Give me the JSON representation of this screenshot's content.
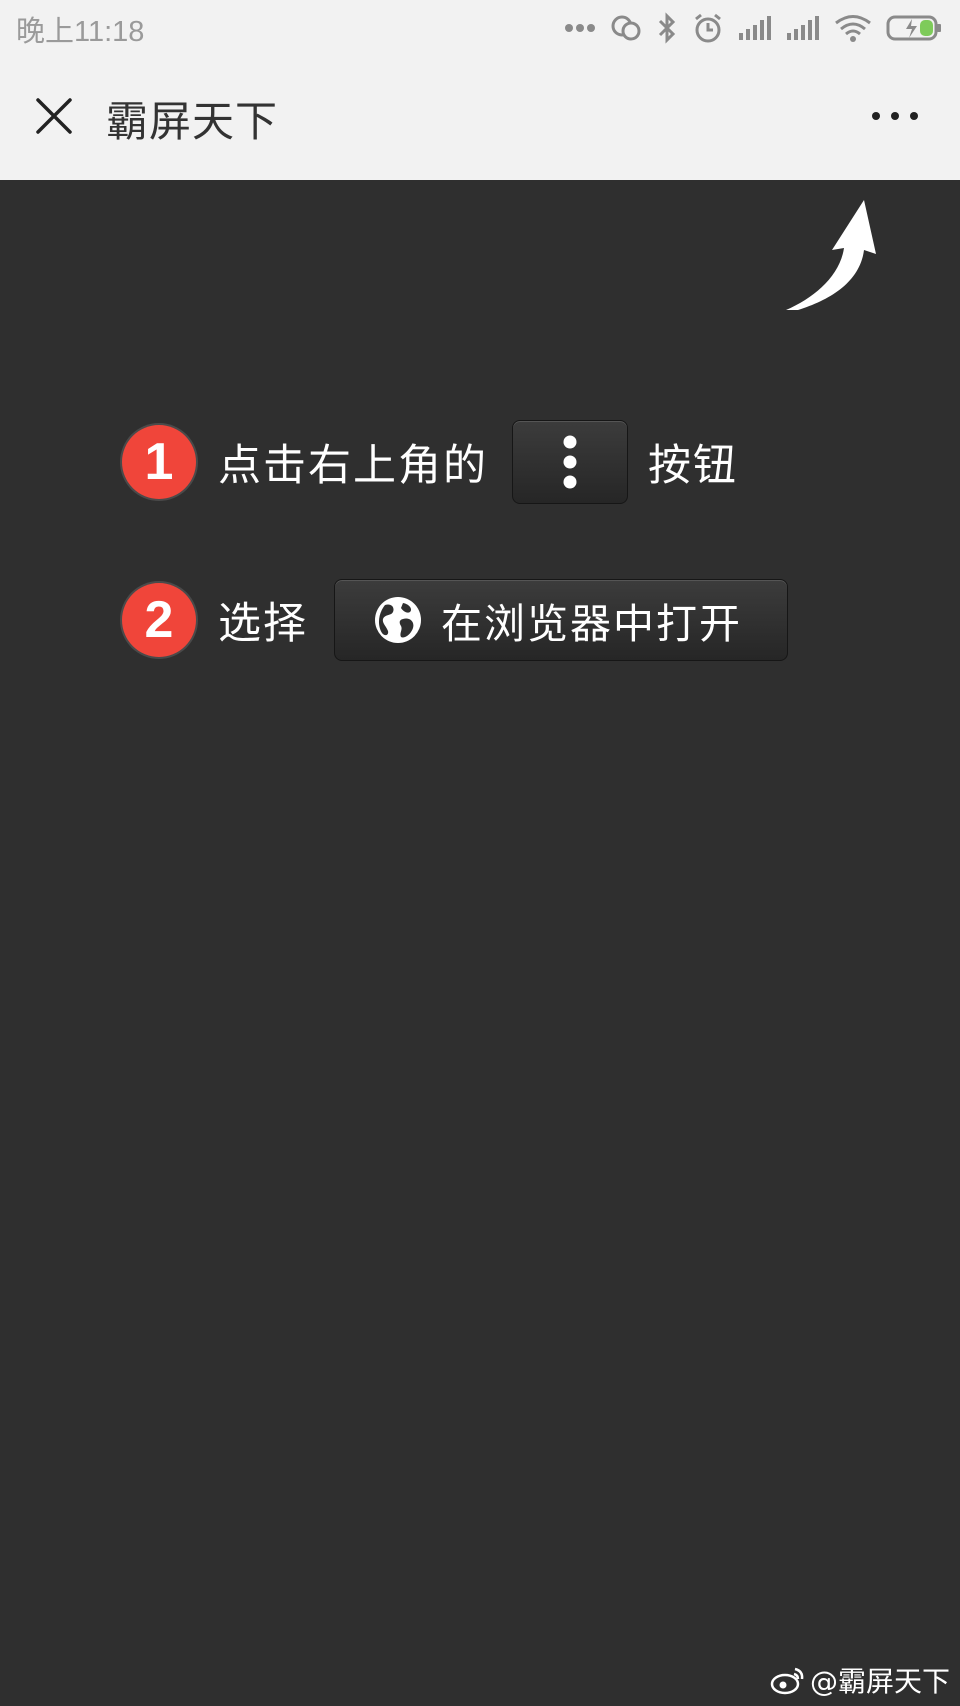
{
  "status_bar": {
    "time": "晚上11:18",
    "icons": [
      "more-dots-icon",
      "hotspot-icon",
      "bluetooth-icon",
      "alarm-icon",
      "signal-icon",
      "signal-icon",
      "wifi-icon",
      "battery-charging-icon"
    ]
  },
  "header": {
    "title": "霸屏天下",
    "close_icon": "close-icon",
    "more_icon": "more-icon"
  },
  "guide": {
    "step1": {
      "number": "1",
      "text_before": "点击右上角的",
      "text_after": "按钮"
    },
    "step2": {
      "number": "2",
      "text_before": "选择",
      "button_label": "在浏览器中打开"
    }
  },
  "watermark": {
    "text": "@霸屏天下"
  },
  "colors": {
    "badge": "#f0453a",
    "background": "#2f2f2f",
    "bar": "#f2f2f2"
  }
}
